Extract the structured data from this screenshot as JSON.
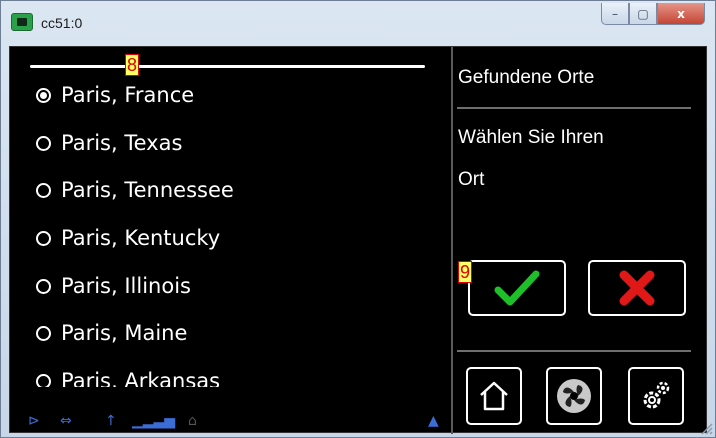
{
  "window": {
    "title": "cc51:0",
    "controls": {
      "minimize": "–",
      "maximize": "▢",
      "close": "x"
    }
  },
  "list": {
    "items": [
      {
        "label": "Paris, France",
        "selected": true
      },
      {
        "label": "Paris, Texas",
        "selected": false
      },
      {
        "label": "Paris, Tennessee",
        "selected": false
      },
      {
        "label": "Paris, Kentucky",
        "selected": false
      },
      {
        "label": "Paris, Illinois",
        "selected": false
      },
      {
        "label": "Paris, Maine",
        "selected": false
      },
      {
        "label": "Paris, Arkansas",
        "selected": false
      }
    ]
  },
  "panel": {
    "title": "Gefundene Orte",
    "instruction_line1": "Wählen Sie Ihren",
    "instruction_line2": "Ort"
  },
  "icons": {
    "confirm": "checkmark-icon",
    "cancel": "x-icon",
    "home": "home-icon",
    "fan": "fan-icon",
    "settings": "gear-icon"
  },
  "colors": {
    "confirm": "#1fbf2a",
    "cancel": "#e01818",
    "status_icons": "#3b6dd6",
    "annotation": "#e00000"
  },
  "annotations": {
    "marker_list": "8",
    "marker_confirm": "9"
  }
}
